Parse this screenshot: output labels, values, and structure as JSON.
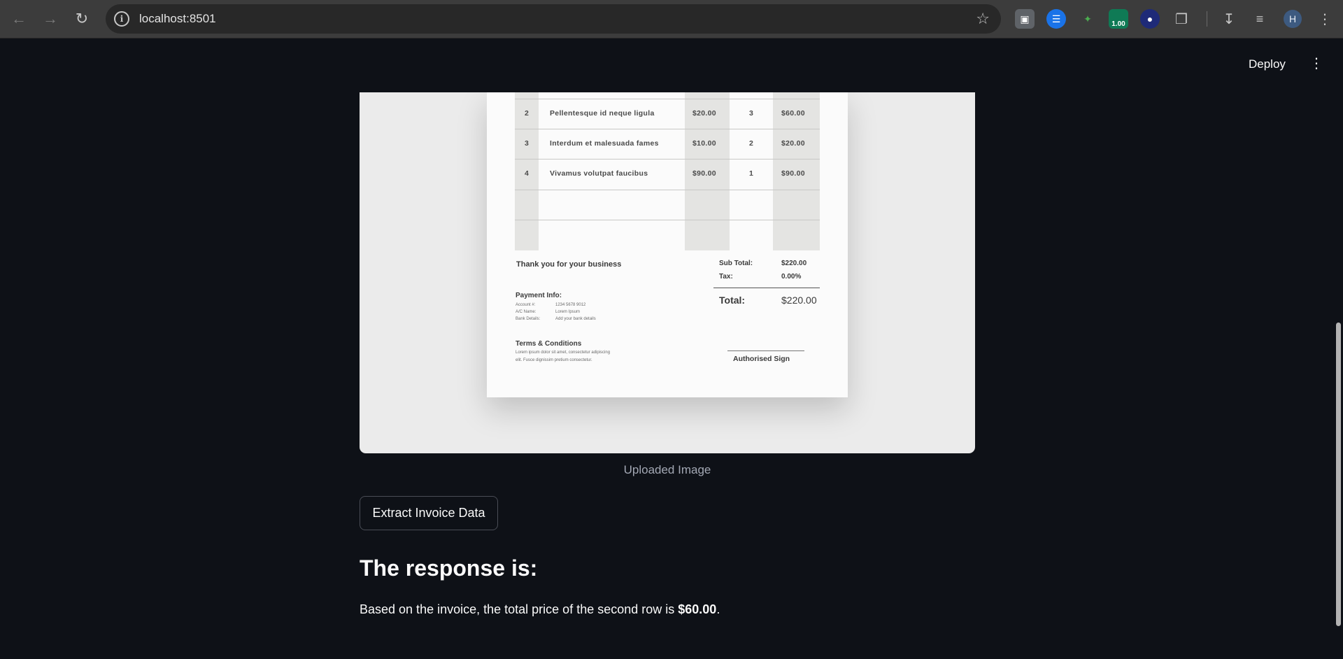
{
  "browser": {
    "url": "localhost:8501",
    "extension_badge": "1.00",
    "profile_initial": "H"
  },
  "app": {
    "deploy_label": "Deploy"
  },
  "invoice": {
    "rows": [
      {
        "no": "2",
        "description": "Pellentesque id neque ligula",
        "price": "$20.00",
        "qty": "3",
        "total": "$60.00"
      },
      {
        "no": "3",
        "description": "Interdum et malesuada fames",
        "price": "$10.00",
        "qty": "2",
        "total": "$20.00"
      },
      {
        "no": "4",
        "description": "Vivamus volutpat faucibus",
        "price": "$90.00",
        "qty": "1",
        "total": "$90.00"
      }
    ],
    "thanks": "Thank you for your business",
    "sub_total_label": "Sub Total:",
    "sub_total_value": "$220.00",
    "tax_label": "Tax:",
    "tax_value": "0.00%",
    "total_label": "Total:",
    "total_value": "$220.00",
    "payment_title": "Payment Info:",
    "payment_lines": [
      {
        "label": "Account #:",
        "value": "1234 5678 9012"
      },
      {
        "label": "A/C Name:",
        "value": "Lorem Ipsum"
      },
      {
        "label": "Bank Details:",
        "value": "Add your bank details"
      }
    ],
    "terms_title": "Terms & Conditions",
    "terms_line1": "Lorem ipsum dolor sit amet, consectetur adipiscing",
    "terms_line2": "elit. Fusce dignissim pretium consectetur.",
    "sign_label": "Authorised Sign"
  },
  "image_caption": "Uploaded Image",
  "extract_button_label": "Extract Invoice Data",
  "response": {
    "title": "The response is:",
    "text_prefix": "Based on the invoice, the total price of the second row is ",
    "text_bold": "$60.00",
    "text_suffix": "."
  }
}
